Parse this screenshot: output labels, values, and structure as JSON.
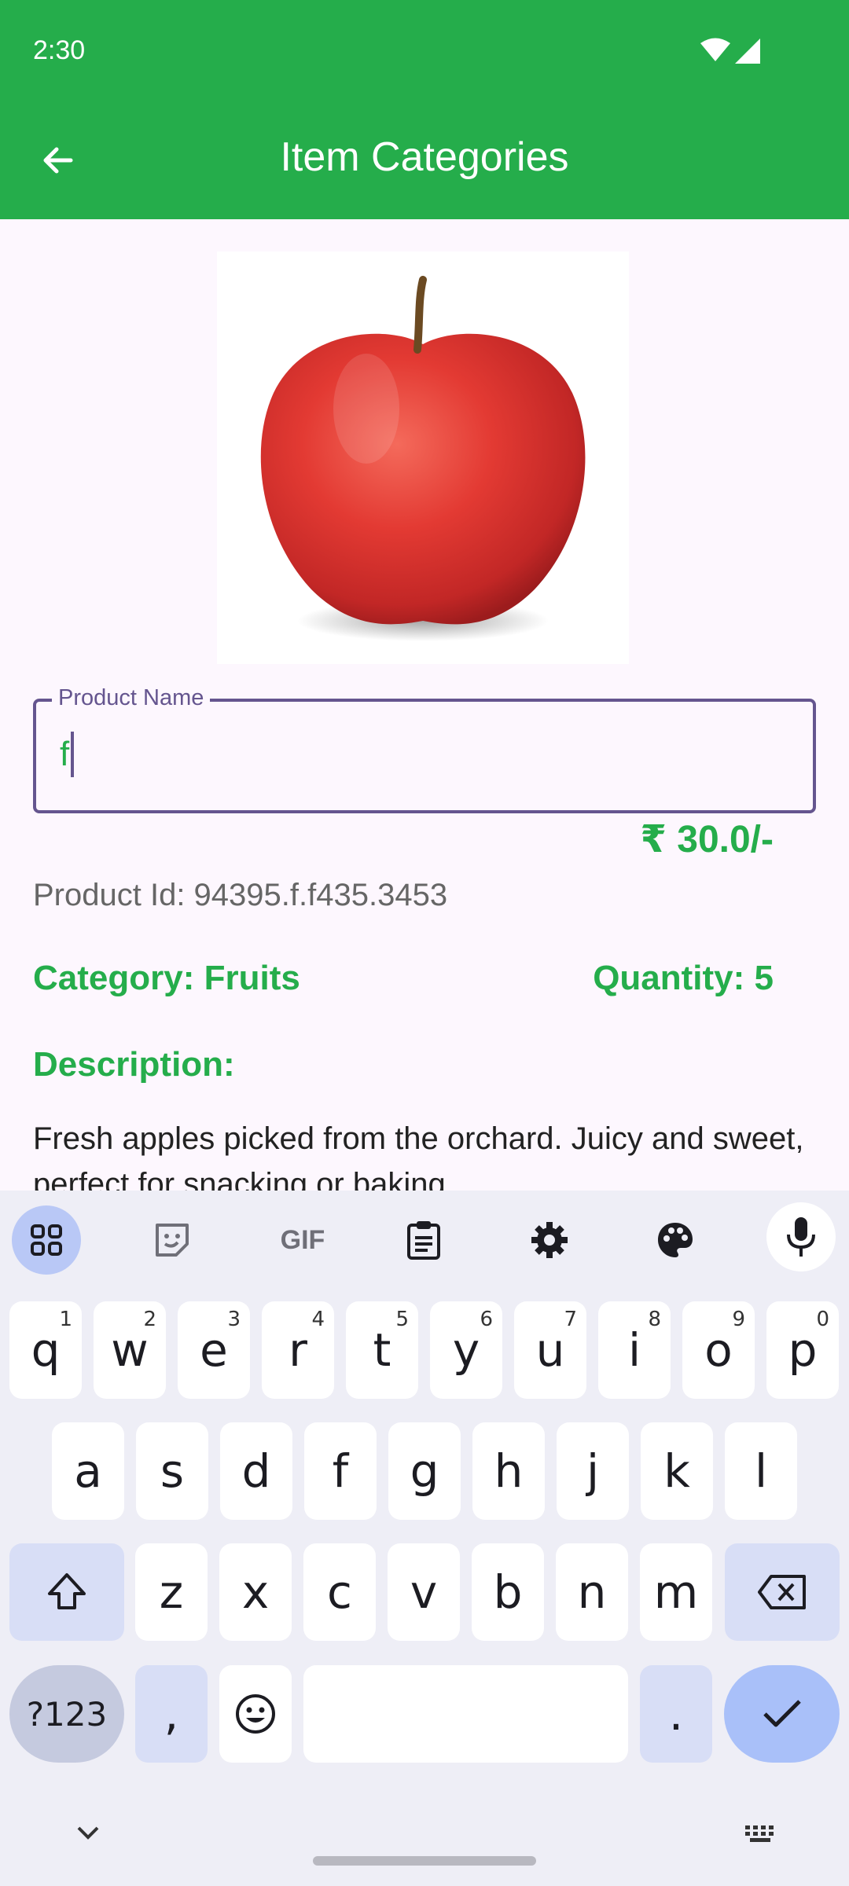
{
  "status": {
    "time": "2:30"
  },
  "appbar": {
    "title": "Item Categories"
  },
  "product": {
    "name_label": "Product Name",
    "name_value": "f",
    "price": "₹ 30.0/-",
    "id_text": "Product Id: 94395.f.f435.3453",
    "category_text": "Category: Fruits",
    "quantity_text": "Quantity: 5",
    "description_heading": "Description:",
    "description_text": "Fresh apples picked from the orchard. Juicy and sweet, perfect for snacking or baking."
  },
  "keyboard": {
    "toolbar": [
      "apps-icon",
      "sticker-icon",
      "GIF",
      "clipboard-icon",
      "settings-icon",
      "palette-icon",
      "mic-icon"
    ],
    "row1": [
      {
        "k": "q",
        "sup": "1"
      },
      {
        "k": "w",
        "sup": "2"
      },
      {
        "k": "e",
        "sup": "3"
      },
      {
        "k": "r",
        "sup": "4"
      },
      {
        "k": "t",
        "sup": "5"
      },
      {
        "k": "y",
        "sup": "6"
      },
      {
        "k": "u",
        "sup": "7"
      },
      {
        "k": "i",
        "sup": "8"
      },
      {
        "k": "o",
        "sup": "9"
      },
      {
        "k": "p",
        "sup": "0"
      }
    ],
    "row2": [
      "a",
      "s",
      "d",
      "f",
      "g",
      "h",
      "j",
      "k",
      "l"
    ],
    "row3": [
      "z",
      "x",
      "c",
      "v",
      "b",
      "n",
      "m"
    ],
    "sym_label": "?123",
    "comma": ",",
    "period": "."
  },
  "colors": {
    "brand_green": "#25ad4b",
    "accent_purple": "#65558f"
  }
}
